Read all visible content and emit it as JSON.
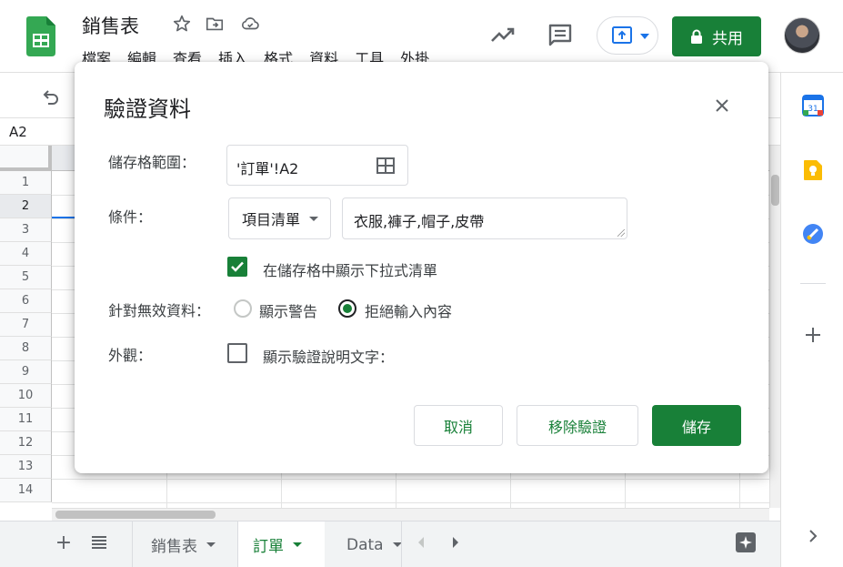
{
  "header": {
    "doc_title": "銷售表",
    "menu": [
      "檔案",
      "編輯",
      "查看",
      "插入",
      "格式",
      "資料",
      "工具",
      "外掛"
    ],
    "share_label": "共用",
    "colors": {
      "brand_green": "#188038",
      "blue": "#1a73e8"
    }
  },
  "formula_bar": {
    "name_box": "A2"
  },
  "grid": {
    "row_numbers": [
      "1",
      "2",
      "3",
      "4",
      "5",
      "6",
      "7",
      "8",
      "9",
      "10",
      "11",
      "12",
      "13",
      "14"
    ],
    "selected_row": "2"
  },
  "sheet_tabs": [
    {
      "label": "銷售表",
      "active": false
    },
    {
      "label": "訂單",
      "active": true
    },
    {
      "label": "Data",
      "active": false
    }
  ],
  "dialog": {
    "title": "驗證資料",
    "range_label": "儲存格範圍：",
    "range_value": "'訂單'!A2",
    "criteria_label": "條件：",
    "criteria_type": "項目清單",
    "criteria_values": "衣服,褲子,帽子,皮帶",
    "show_dropdown_label": "在儲存格中顯示下拉式清單",
    "show_dropdown_checked": true,
    "invalid_label": "針對無效資料：",
    "invalid_options": [
      "顯示警告",
      "拒絕輸入內容"
    ],
    "invalid_selected": "拒絕輸入內容",
    "appearance_label": "外觀：",
    "appearance_option": "顯示驗證說明文字：",
    "appearance_checked": false,
    "buttons": {
      "cancel": "取消",
      "remove": "移除驗證",
      "save": "儲存"
    }
  },
  "icons": [
    "sheets-logo",
    "star-icon",
    "move-to-folder-icon",
    "cloud-status-icon",
    "activity-trend-icon",
    "comment-icon",
    "present-icon",
    "lock-icon",
    "avatar",
    "undo-icon",
    "close-icon",
    "grid-select-icon",
    "calendar-icon",
    "keep-icon",
    "tasks-icon",
    "add-addon-icon",
    "expand-panel-icon",
    "add-sheet-icon",
    "all-sheets-icon",
    "explore-icon"
  ]
}
